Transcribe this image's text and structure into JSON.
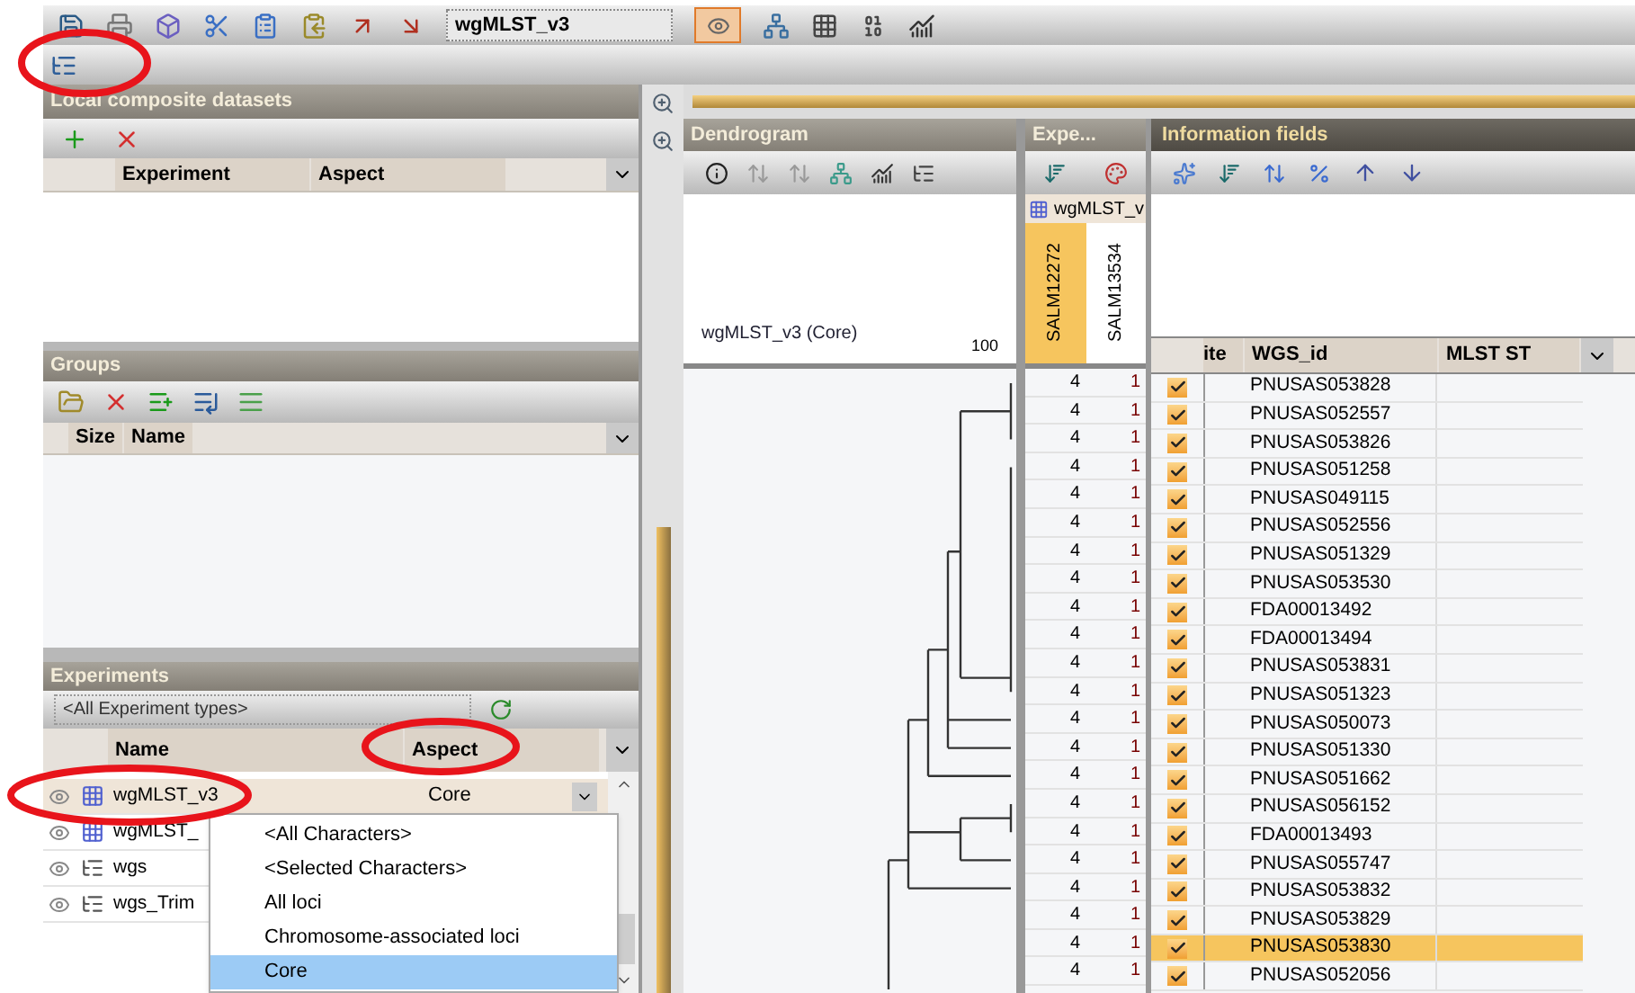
{
  "toolbar": {
    "dataset_field": {
      "value": "wgMLST_v3"
    },
    "view_toggle": {
      "on": true
    }
  },
  "zoom_slider": {
    "level": 1
  },
  "local_composite_datasets": {
    "title": "Local composite datasets",
    "columns": [
      "Experiment",
      "Aspect"
    ]
  },
  "groups": {
    "title": "Groups",
    "columns": [
      "Size",
      "Name"
    ]
  },
  "experiments": {
    "title": "Experiments",
    "filter": {
      "value": "<All Experiment types>"
    },
    "columns": [
      "Name",
      "Aspect"
    ],
    "rows": [
      {
        "name": "wgMLST_v3",
        "aspect": "Core",
        "kind": "matrix",
        "selected": true
      },
      {
        "name": "wgMLST_",
        "kind": "matrix",
        "selected": false
      },
      {
        "name": "wgs",
        "kind": "sequence",
        "selected": false
      },
      {
        "name": "wgs_Trim",
        "kind": "sequence",
        "selected": false
      }
    ],
    "aspect_menu": {
      "options": [
        {
          "label": "<All Characters>",
          "selected": false
        },
        {
          "label": "<Selected Characters>",
          "selected": false
        },
        {
          "label": "All loci",
          "selected": false
        },
        {
          "label": "Chromosome-associated loci",
          "selected": false
        },
        {
          "label": "Core",
          "selected": true
        }
      ]
    }
  },
  "dendrogram": {
    "title": "Dendrogram",
    "caption": "wgMLST_v3 (Core)",
    "scale_label": "100"
  },
  "experiment_panel": {
    "title": "Expe...",
    "experiment": "wgMLST_v",
    "columns": [
      {
        "label": "SALM12272",
        "selected": true
      },
      {
        "label": "SALM13534",
        "selected": false
      }
    ]
  },
  "information_fields": {
    "title": "Information fields",
    "columns": [
      "ite",
      "WGS_id",
      "MLST ST"
    ]
  },
  "entries": [
    {
      "values": [
        "4",
        "1"
      ],
      "checked": true,
      "wgs_id": "PNUSAS053828",
      "selected": false
    },
    {
      "values": [
        "4",
        "1"
      ],
      "checked": true,
      "wgs_id": "PNUSAS052557",
      "selected": false
    },
    {
      "values": [
        "4",
        "1"
      ],
      "checked": true,
      "wgs_id": "PNUSAS053826",
      "selected": false
    },
    {
      "values": [
        "4",
        "1"
      ],
      "checked": true,
      "wgs_id": "PNUSAS051258",
      "selected": false
    },
    {
      "values": [
        "4",
        "1"
      ],
      "checked": true,
      "wgs_id": "PNUSAS049115",
      "selected": false
    },
    {
      "values": [
        "4",
        "1"
      ],
      "checked": true,
      "wgs_id": "PNUSAS052556",
      "selected": false
    },
    {
      "values": [
        "4",
        "1"
      ],
      "checked": true,
      "wgs_id": "PNUSAS051329",
      "selected": false
    },
    {
      "values": [
        "4",
        "1"
      ],
      "checked": true,
      "wgs_id": "PNUSAS053530",
      "selected": false
    },
    {
      "values": [
        "4",
        "1"
      ],
      "checked": true,
      "wgs_id": "FDA00013492",
      "selected": false
    },
    {
      "values": [
        "4",
        "1"
      ],
      "checked": true,
      "wgs_id": "FDA00013494",
      "selected": false
    },
    {
      "values": [
        "4",
        "1"
      ],
      "checked": true,
      "wgs_id": "PNUSAS053831",
      "selected": false
    },
    {
      "values": [
        "4",
        "1"
      ],
      "checked": true,
      "wgs_id": "PNUSAS051323",
      "selected": false
    },
    {
      "values": [
        "4",
        "1"
      ],
      "checked": true,
      "wgs_id": "PNUSAS050073",
      "selected": false
    },
    {
      "values": [
        "4",
        "1"
      ],
      "checked": true,
      "wgs_id": "PNUSAS051330",
      "selected": false
    },
    {
      "values": [
        "4",
        "1"
      ],
      "checked": true,
      "wgs_id": "PNUSAS051662",
      "selected": false
    },
    {
      "values": [
        "4",
        "1"
      ],
      "checked": true,
      "wgs_id": "PNUSAS056152",
      "selected": false
    },
    {
      "values": [
        "4",
        "1"
      ],
      "checked": true,
      "wgs_id": "FDA00013493",
      "selected": false
    },
    {
      "values": [
        "4",
        "1"
      ],
      "checked": true,
      "wgs_id": "PNUSAS055747",
      "selected": false
    },
    {
      "values": [
        "4",
        "1"
      ],
      "checked": true,
      "wgs_id": "PNUSAS053832",
      "selected": false
    },
    {
      "values": [
        "4",
        "1"
      ],
      "checked": true,
      "wgs_id": "PNUSAS053829",
      "selected": false
    },
    {
      "values": [
        "4",
        "1"
      ],
      "checked": true,
      "wgs_id": "PNUSAS053830",
      "selected": true
    },
    {
      "values": [
        "4",
        "1"
      ],
      "checked": true,
      "wgs_id": "PNUSAS052056",
      "selected": false
    }
  ]
}
